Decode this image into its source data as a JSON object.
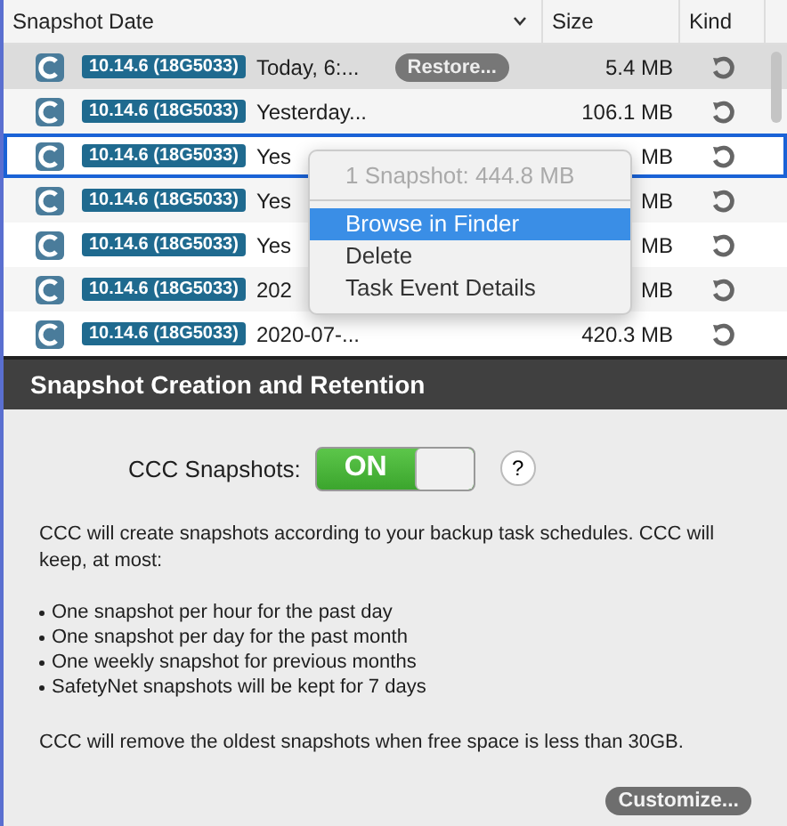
{
  "table": {
    "columns": [
      {
        "label": "Snapshot Date"
      },
      {
        "label": "Size"
      },
      {
        "label": "Kind"
      }
    ],
    "rows": [
      {
        "version": "10.14.6 (18G5033)",
        "date": "Today, 6:...",
        "action": "Restore...",
        "size": "5.4 MB",
        "selected": true,
        "focused": false
      },
      {
        "version": "10.14.6 (18G5033)",
        "date": "Yesterday...",
        "size": "106.1 MB",
        "selected": false,
        "focused": false
      },
      {
        "version": "10.14.6 (18G5033)",
        "date": "Yes",
        "size": "MB",
        "selected": false,
        "focused": true
      },
      {
        "version": "10.14.6 (18G5033)",
        "date": "Yes",
        "size": "MB",
        "selected": false,
        "focused": false
      },
      {
        "version": "10.14.6 (18G5033)",
        "date": "Yes",
        "size": "MB",
        "selected": false,
        "focused": false
      },
      {
        "version": "10.14.6 (18G5033)",
        "date": "202",
        "size": "MB",
        "selected": false,
        "focused": false
      },
      {
        "version": "10.14.6 (18G5033)",
        "date": "2020-07-...",
        "size": "420.3 MB",
        "selected": false,
        "focused": false
      }
    ]
  },
  "context_menu": {
    "header": "1 Snapshot: 444.8 MB",
    "items": [
      {
        "label": "Browse in Finder",
        "selected": true
      },
      {
        "label": "Delete",
        "selected": false
      },
      {
        "label": "Task Event Details",
        "selected": false
      }
    ]
  },
  "section": {
    "title": "Snapshot Creation and Retention",
    "toggle": {
      "label": "CCC Snapshots:",
      "text": "ON",
      "on": true
    },
    "help": "?",
    "intro": "CCC will create snapshots according to your backup task schedules. CCC will keep, at most:",
    "bullets": [
      "One snapshot per hour for the past day",
      "One snapshot per day for the past month",
      "One weekly snapshot for previous months",
      "SafetyNet snapshots will be kept for 7 days"
    ],
    "note": "CCC will remove the oldest snapshots when free space is less than 30GB.",
    "button": "Customize..."
  }
}
